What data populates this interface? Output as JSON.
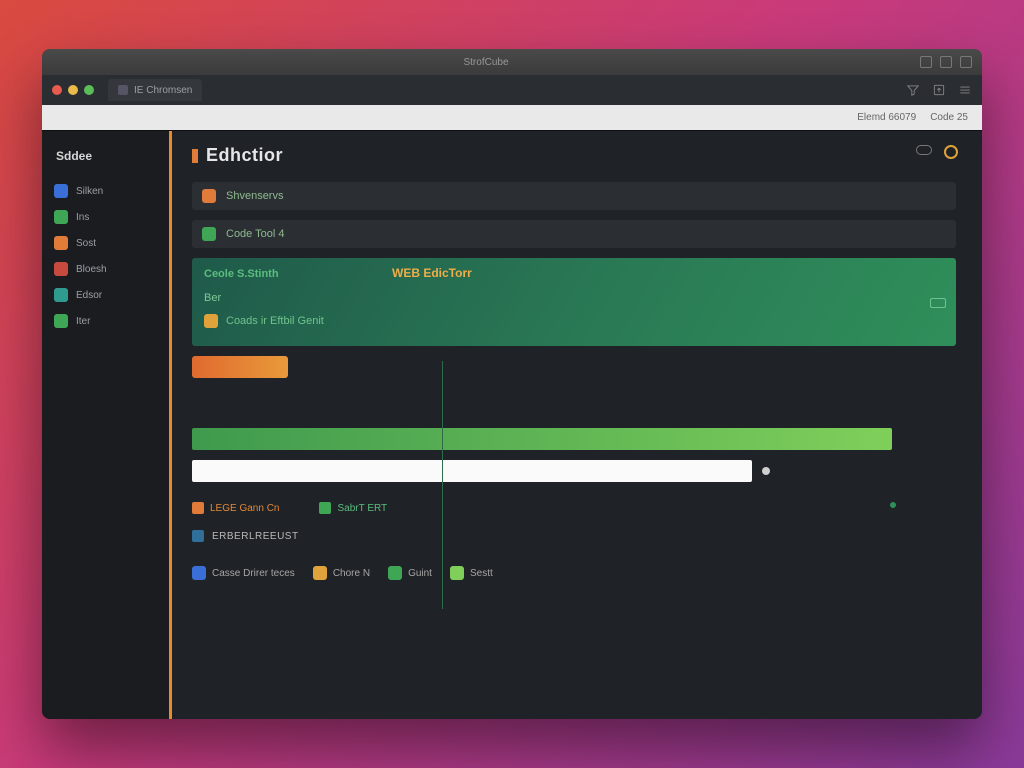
{
  "chrome": {
    "title": "StrofCube"
  },
  "titlebar": {
    "tab_label": "IE Chromsen"
  },
  "urlbar": {
    "status": "Elemd 66079",
    "code": "Code 25"
  },
  "sidebar": {
    "title": "Sddee",
    "items": [
      {
        "label": "Silken",
        "color": "ic-blue"
      },
      {
        "label": "Ins",
        "color": "ic-green"
      },
      {
        "label": "Sost",
        "color": "ic-orange"
      },
      {
        "label": "Bloesh",
        "color": "ic-red"
      },
      {
        "label": "Edsor",
        "color": "ic-teal"
      },
      {
        "label": "Iter",
        "color": "ic-green"
      }
    ]
  },
  "main": {
    "title": "Edhctior",
    "rows": [
      {
        "label": "Shvenservs",
        "style": "orange"
      },
      {
        "label": "Code Tool 4",
        "style": "green"
      }
    ],
    "hero": {
      "line1": "Ceole S.Stinth",
      "line2": "WEB EdicTorr",
      "line3": "Ber",
      "line4": "Coads  ir Eftbil Genit"
    },
    "legend": [
      {
        "label": "LEGE Gann Cn",
        "cls": "or",
        "sw": "#e07b3a"
      },
      {
        "label": "SabrT ERT",
        "cls": "gr",
        "sw": "#3fa656"
      }
    ],
    "section_title": "ERBERLREEUST",
    "toolbar": [
      {
        "label": "Casse Drirer teces",
        "color": "#3a6fd8"
      },
      {
        "label": "Chore N",
        "color": "#e0a23a"
      },
      {
        "label": "Guint",
        "color": "#3fa656"
      },
      {
        "label": "Sestt",
        "color": "#7fcf5a"
      }
    ]
  }
}
